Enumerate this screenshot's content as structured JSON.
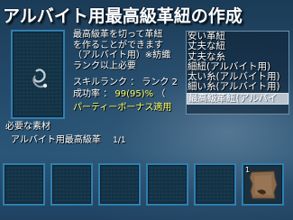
{
  "title": "アルバイト用最高級革紐の作成",
  "description": {
    "lines": [
      "最高級革を切って革紐",
      "を作ることができます",
      "（アルバイト用）※紡織",
      "ランク以上必要"
    ],
    "rank_char": "C"
  },
  "stats": {
    "skill_rank_label": "スキルランク",
    "skill_rank_sep": "：",
    "skill_rank_value": "ランク 2",
    "success_label": "成功率",
    "success_sep": "：",
    "success_value": "99(95)%",
    "success_paren": "（"
  },
  "party_bonus": "パーティーボーナス適用",
  "recipe_list": [
    "安い革紐",
    "丈夫な紐",
    "丈夫な糸",
    "細紐(アルバイト用)",
    "太い糸(アルバイト用)",
    "細い糸(アルバイト用)",
    "最高級革紐(アルバイ"
  ],
  "selected_index": 6,
  "materials": {
    "label": "必要な素材",
    "item_name": "アルバイト用最高級革",
    "item_count": "1/1"
  },
  "slots": {
    "filled_badge": "1",
    "filled_icon": "leather-hide-icon"
  }
}
